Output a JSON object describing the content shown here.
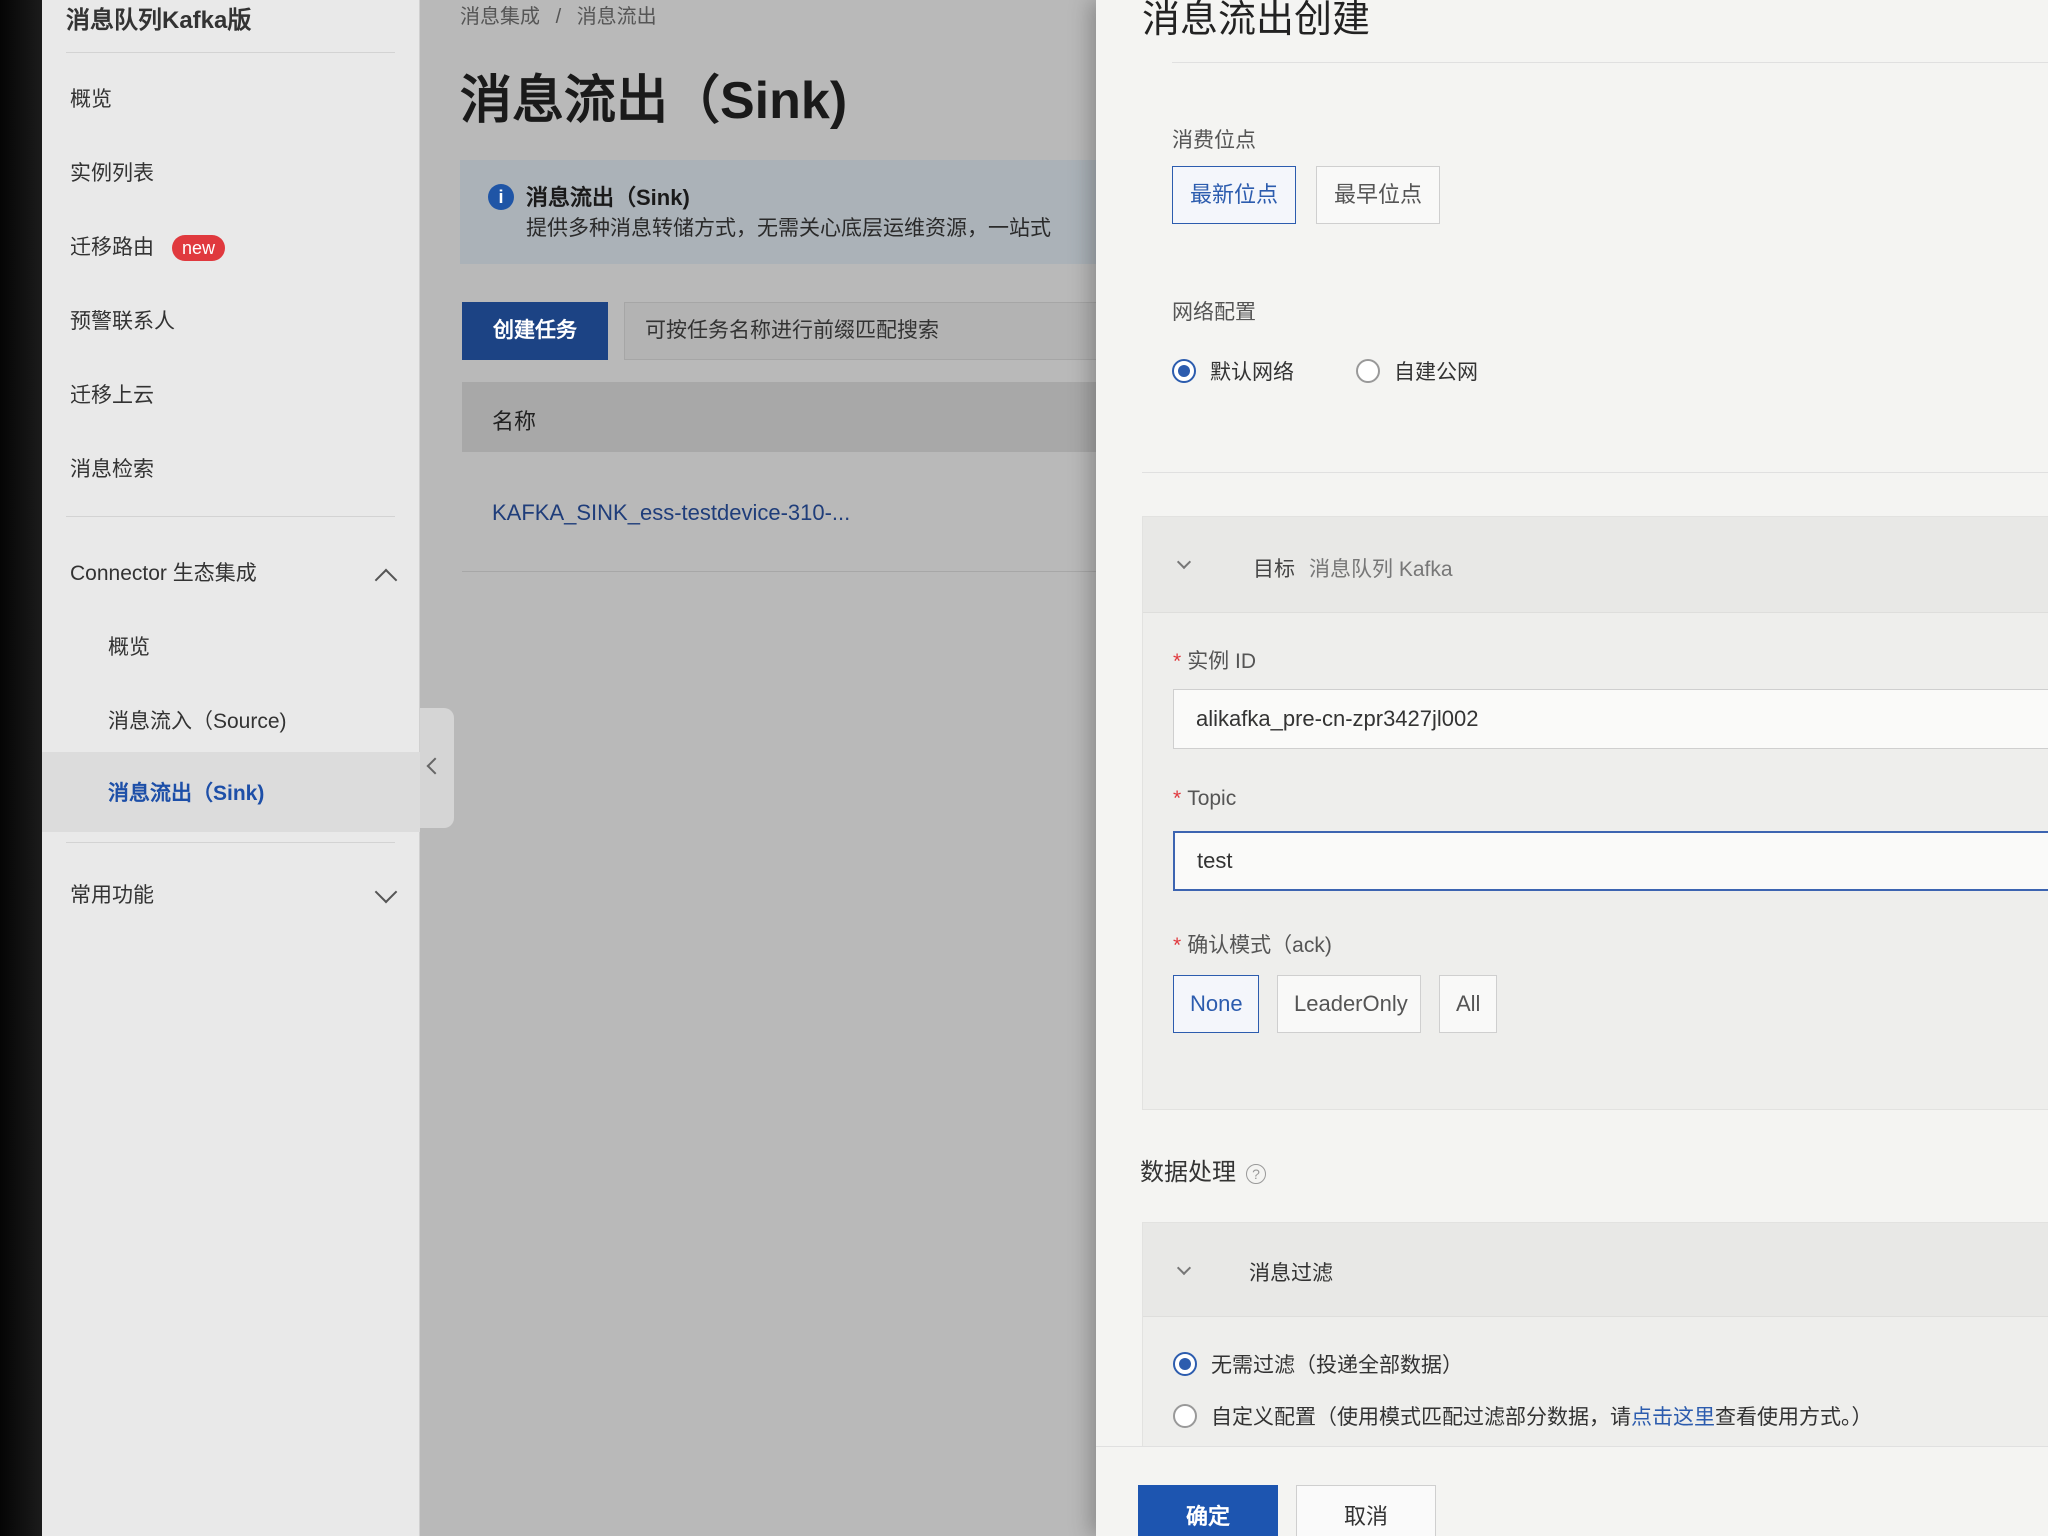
{
  "sidebar": {
    "title": "消息队列Kafka版",
    "items": [
      {
        "label": "概览"
      },
      {
        "label": "实例列表"
      },
      {
        "label": "迁移路由",
        "badge": "new"
      },
      {
        "label": "预警联系人"
      },
      {
        "label": "迁移上云"
      },
      {
        "label": "消息检索"
      }
    ],
    "connector_group": {
      "label": "Connector 生态集成",
      "children": [
        {
          "label": "概览"
        },
        {
          "label": "消息流入（Source)"
        },
        {
          "label": "消息流出（Sink)"
        }
      ]
    },
    "common_group": {
      "label": "常用功能"
    }
  },
  "main": {
    "breadcrumb": [
      "消息集成",
      "/",
      "消息流出"
    ],
    "title": "消息流出（Sink)",
    "info": {
      "title": "消息流出（Sink)",
      "text": "提供多种消息转储方式，无需关心底层运维资源，一站式"
    },
    "create_button": "创建任务",
    "search_placeholder": "可按任务名称进行前缀匹配搜索",
    "table": {
      "column_name": "名称",
      "rows": [
        {
          "name": "KAFKA_SINK_ess-testdevice-310-..."
        }
      ]
    }
  },
  "drawer": {
    "title": "消息流出创建",
    "consume_offset": {
      "label": "消费位点",
      "options": [
        "最新位点",
        "最早位点"
      ],
      "selected": "最新位点"
    },
    "network": {
      "label": "网络配置",
      "options": [
        "默认网络",
        "自建公网"
      ],
      "selected": "默认网络"
    },
    "target": {
      "label": "目标",
      "value": "消息队列 Kafka",
      "instance_id": {
        "label": "实例 ID",
        "value": "alikafka_pre-cn-zpr3427jl002"
      },
      "topic": {
        "label": "Topic",
        "value": "test"
      },
      "ack": {
        "label": "确认模式（ack)",
        "options": [
          "None",
          "LeaderOnly",
          "All"
        ],
        "selected": "None"
      }
    },
    "data_processing": {
      "label": "数据处理",
      "help_icon": "?",
      "filter": {
        "label": "消息过滤",
        "options": [
          {
            "label": "无需过滤（投递全部数据）",
            "selected": true
          },
          {
            "label": "自定义配置（使用模式匹配过滤部分数据，请",
            "link": "点击这里",
            "suffix": "查看使用方式。）",
            "selected": false
          }
        ]
      }
    },
    "ok_button": "确定",
    "cancel_button": "取消"
  },
  "colors": {
    "primary": "#2c5cae",
    "primary_dark": "#1c4384",
    "badge_red": "#e0393e"
  }
}
